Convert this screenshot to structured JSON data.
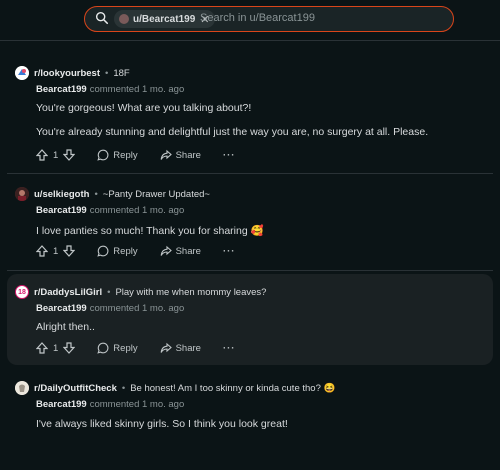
{
  "search": {
    "chip_label": "u/Bearcat199",
    "placeholder": "Search in u/Bearcat199"
  },
  "comments": [
    {
      "subreddit": "r/lookyourbest",
      "post_title": "18F",
      "user": "Bearcat199",
      "meta": "commented 1 mo. ago",
      "paragraphs": [
        "You're gorgeous! What are you talking about?!",
        "You're already stunning and delightful just the way you are, no surgery at all. Please."
      ],
      "votes": "1",
      "reply": "Reply",
      "share": "Share"
    },
    {
      "subreddit": "u/selkiegoth",
      "post_title": "~Panty Drawer Updated~",
      "user": "Bearcat199",
      "meta": "commented 1 mo. ago",
      "paragraphs": [
        "I love panties so much! Thank you for sharing 🥰"
      ],
      "votes": "1",
      "reply": "Reply",
      "share": "Share"
    },
    {
      "subreddit": "r/DaddysLilGirl",
      "sub_icon_text": "18",
      "post_title": "Play with me when mommy leaves?",
      "user": "Bearcat199",
      "meta": "commented 1 mo. ago",
      "paragraphs": [
        "Alright then.."
      ],
      "votes": "1",
      "reply": "Reply",
      "share": "Share"
    },
    {
      "subreddit": "r/DailyOutfitCheck",
      "post_title": "Be honest! Am I too skinny or kinda cute tho? 😆",
      "user": "Bearcat199",
      "meta": "commented 1 mo. ago",
      "paragraphs": [
        "I've always liked skinny girls. So I think you look great!"
      ]
    }
  ],
  "more_glyph": "···",
  "colors": {
    "accent": "#d9451a",
    "background": "#0b1416",
    "nsfw_badge": "#d4176b"
  }
}
